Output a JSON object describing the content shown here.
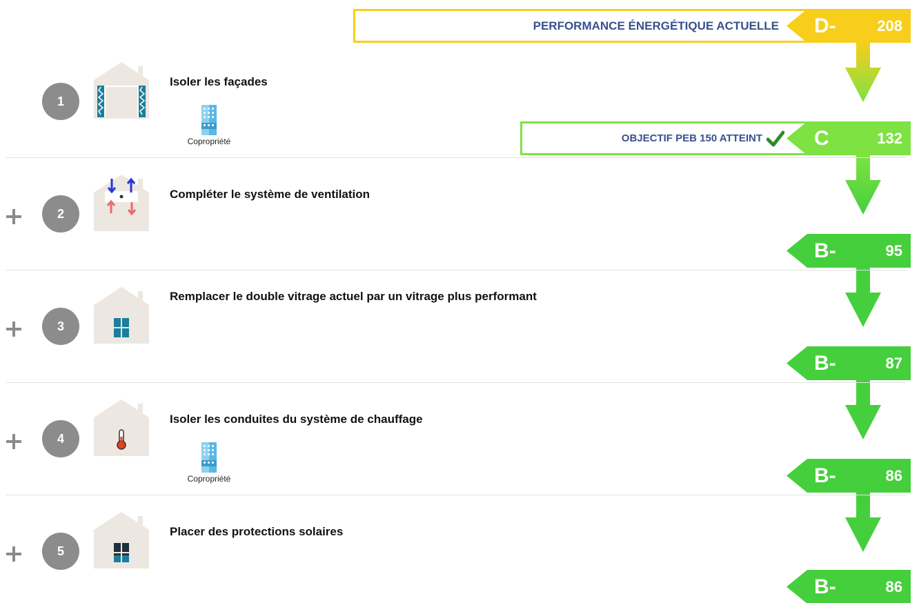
{
  "colors": {
    "current_yellow": "#f7ce1c",
    "green_bright": "#7ee242",
    "green": "#46cf3d",
    "step_grey": "#8c8c8c",
    "title_blue": "#37518e",
    "check_green": "#2f8a2a"
  },
  "current": {
    "label": "PERFORMANCE ÉNERGÉTIQUE ACTUELLE",
    "letter": "D-",
    "value": "208"
  },
  "objective": {
    "label": "OBJECTIF PEB 150 ATTEINT",
    "icon": "check-icon",
    "letter": "C",
    "value": "132"
  },
  "steps": [
    {
      "number": "1",
      "title": "Isoler les façades",
      "icon": "facade-insulation-icon",
      "copro_label": "Copropriété"
    },
    {
      "number": "2",
      "title": "Compléter le système de ventilation",
      "icon": "ventilation-icon"
    },
    {
      "number": "3",
      "title": "Remplacer le double vitrage actuel par un vitrage plus performant",
      "icon": "window-icon"
    },
    {
      "number": "4",
      "title": "Isoler les conduites du système de chauffage",
      "icon": "thermometer-icon",
      "copro_label": "Copropriété"
    },
    {
      "number": "5",
      "title": "Placer des protections solaires",
      "icon": "sun-shade-icon"
    }
  ],
  "results": [
    {
      "letter": "B-",
      "value": "95"
    },
    {
      "letter": "B-",
      "value": "87"
    },
    {
      "letter": "B-",
      "value": "86"
    },
    {
      "letter": "B-",
      "value": "86"
    }
  ]
}
